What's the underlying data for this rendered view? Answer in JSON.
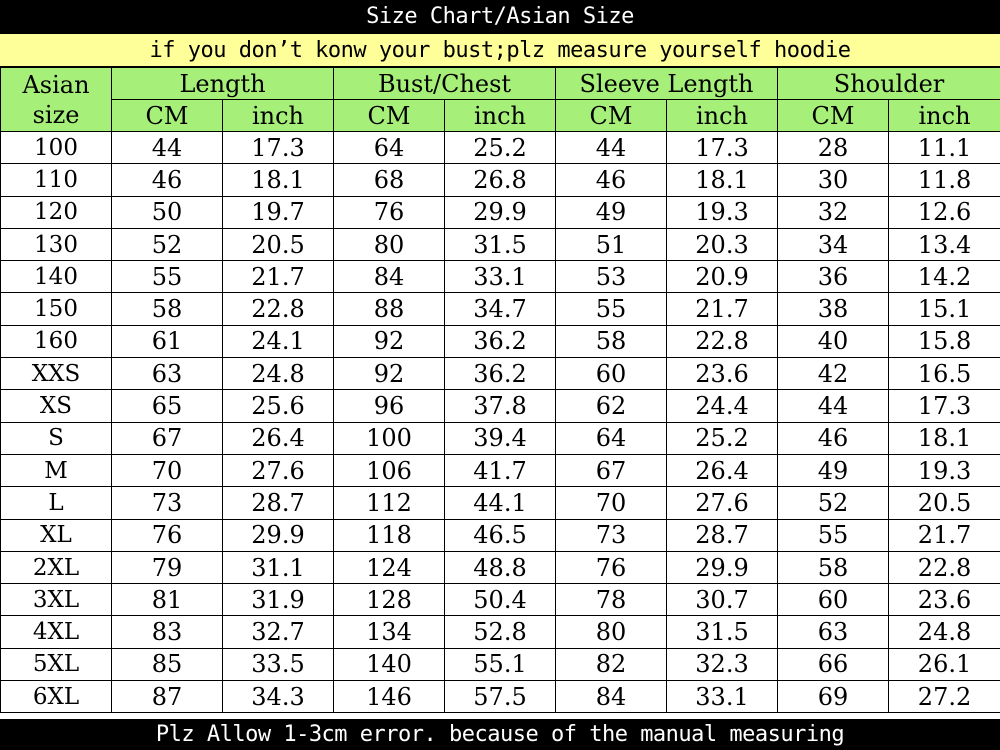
{
  "header": {
    "title": "Size Chart/Asian Size",
    "note": "if you don’t konw your bust;plz measure yourself hoodie"
  },
  "columns": {
    "size": [
      "Asian",
      "size"
    ],
    "groups": [
      "Length",
      "Bust/Chest",
      "Sleeve Length",
      "Shoulder"
    ],
    "units": [
      "CM",
      "inch"
    ]
  },
  "rows": [
    [
      "100",
      "44",
      "17.3",
      "64",
      "25.2",
      "44",
      "17.3",
      "28",
      "11.1"
    ],
    [
      "110",
      "46",
      "18.1",
      "68",
      "26.8",
      "46",
      "18.1",
      "30",
      "11.8"
    ],
    [
      "120",
      "50",
      "19.7",
      "76",
      "29.9",
      "49",
      "19.3",
      "32",
      "12.6"
    ],
    [
      "130",
      "52",
      "20.5",
      "80",
      "31.5",
      "51",
      "20.3",
      "34",
      "13.4"
    ],
    [
      "140",
      "55",
      "21.7",
      "84",
      "33.1",
      "53",
      "20.9",
      "36",
      "14.2"
    ],
    [
      "150",
      "58",
      "22.8",
      "88",
      "34.7",
      "55",
      "21.7",
      "38",
      "15.1"
    ],
    [
      "160",
      "61",
      "24.1",
      "92",
      "36.2",
      "58",
      "22.8",
      "40",
      "15.8"
    ],
    [
      "XXS",
      "63",
      "24.8",
      "92",
      "36.2",
      "60",
      "23.6",
      "42",
      "16.5"
    ],
    [
      "XS",
      "65",
      "25.6",
      "96",
      "37.8",
      "62",
      "24.4",
      "44",
      "17.3"
    ],
    [
      "S",
      "67",
      "26.4",
      "100",
      "39.4",
      "64",
      "25.2",
      "46",
      "18.1"
    ],
    [
      "M",
      "70",
      "27.6",
      "106",
      "41.7",
      "67",
      "26.4",
      "49",
      "19.3"
    ],
    [
      "L",
      "73",
      "28.7",
      "112",
      "44.1",
      "70",
      "27.6",
      "52",
      "20.5"
    ],
    [
      "XL",
      "76",
      "29.9",
      "118",
      "46.5",
      "73",
      "28.7",
      "55",
      "21.7"
    ],
    [
      "2XL",
      "79",
      "31.1",
      "124",
      "48.8",
      "76",
      "29.9",
      "58",
      "22.8"
    ],
    [
      "3XL",
      "81",
      "31.9",
      "128",
      "50.4",
      "78",
      "30.7",
      "60",
      "23.6"
    ],
    [
      "4XL",
      "83",
      "32.7",
      "134",
      "52.8",
      "80",
      "31.5",
      "63",
      "24.8"
    ],
    [
      "5XL",
      "85",
      "33.5",
      "140",
      "55.1",
      "82",
      "32.3",
      "66",
      "26.1"
    ],
    [
      "6XL",
      "87",
      "34.3",
      "146",
      "57.5",
      "84",
      "33.1",
      "69",
      "27.2"
    ]
  ],
  "footer": {
    "note": "Plz Allow 1-3cm error. because of the manual measuring"
  },
  "colors": {
    "header_green": "#a6f07a",
    "note_yellow": "#ffff99",
    "banner_black": "#000000"
  }
}
